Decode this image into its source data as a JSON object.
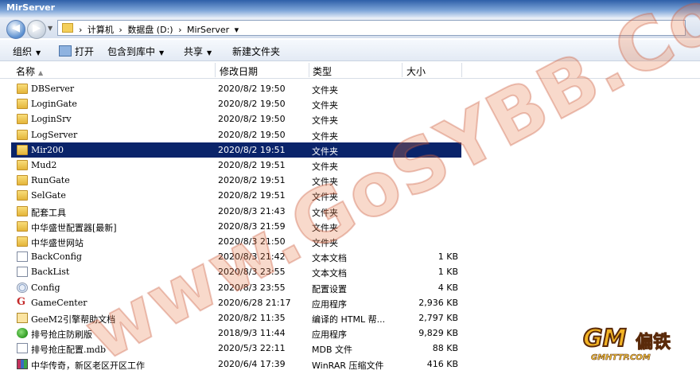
{
  "window": {
    "title": "MirServer"
  },
  "address": {
    "crumbs": [
      "›",
      "计算机",
      "›",
      "数据盘 (D:)",
      "›",
      "MirServer",
      "▾"
    ]
  },
  "toolbar": {
    "organize": "组织",
    "open": "打开",
    "include_in_library": "包含到库中",
    "share": "共享",
    "new_folder": "新建文件夹"
  },
  "columns": {
    "name": "名称",
    "date": "修改日期",
    "type": "类型",
    "size": "大小"
  },
  "files": [
    {
      "name": "DBServer",
      "date": "2020/8/2 19:50",
      "type": "文件夹",
      "size": "",
      "icon": "folder-icon"
    },
    {
      "name": "LoginGate",
      "date": "2020/8/2 19:50",
      "type": "文件夹",
      "size": "",
      "icon": "folder-icon"
    },
    {
      "name": "LoginSrv",
      "date": "2020/8/2 19:50",
      "type": "文件夹",
      "size": "",
      "icon": "folder-icon"
    },
    {
      "name": "LogServer",
      "date": "2020/8/2 19:50",
      "type": "文件夹",
      "size": "",
      "icon": "folder-icon"
    },
    {
      "name": "Mir200",
      "date": "2020/8/2 19:51",
      "type": "文件夹",
      "size": "",
      "icon": "folder-icon",
      "selected": true
    },
    {
      "name": "Mud2",
      "date": "2020/8/2 19:51",
      "type": "文件夹",
      "size": "",
      "icon": "folder-icon"
    },
    {
      "name": "RunGate",
      "date": "2020/8/2 19:51",
      "type": "文件夹",
      "size": "",
      "icon": "folder-icon"
    },
    {
      "name": "SelGate",
      "date": "2020/8/2 19:51",
      "type": "文件夹",
      "size": "",
      "icon": "folder-icon"
    },
    {
      "name": "配套工具",
      "date": "2020/8/3 21:43",
      "type": "文件夹",
      "size": "",
      "icon": "folder-icon"
    },
    {
      "name": "中华盛世配置器[最新]",
      "date": "2020/8/3 21:59",
      "type": "文件夹",
      "size": "",
      "icon": "folder-icon"
    },
    {
      "name": "中华盛世网站",
      "date": "2020/8/3 21:50",
      "type": "文件夹",
      "size": "",
      "icon": "folder-icon"
    },
    {
      "name": "BackConfig",
      "date": "2020/8/3 21:42",
      "type": "文本文档",
      "size": "1 KB",
      "icon": "text-document-icon"
    },
    {
      "name": "BackList",
      "date": "2020/8/3 23:55",
      "type": "文本文档",
      "size": "1 KB",
      "icon": "text-document-icon"
    },
    {
      "name": "Config",
      "date": "2020/8/3 23:55",
      "type": "配置设置",
      "size": "4 KB",
      "icon": "config-icon"
    },
    {
      "name": "GameCenter",
      "date": "2020/6/28 21:17",
      "type": "应用程序",
      "size": "2,936 KB",
      "icon": "gamecenter-app-icon"
    },
    {
      "name": "GeeM2引擎帮助文档",
      "date": "2020/8/2 11:35",
      "type": "编译的 HTML 帮...",
      "size": "2,797 KB",
      "icon": "help-document-icon"
    },
    {
      "name": "排号抢庄防刷版",
      "date": "2018/9/3 11:44",
      "type": "应用程序",
      "size": "9,829 KB",
      "icon": "apple-app-icon"
    },
    {
      "name": "排号抢庄配置.mdb",
      "date": "2020/5/3 22:11",
      "type": "MDB 文件",
      "size": "88 KB",
      "icon": "mdb-file-icon"
    },
    {
      "name": "中华传奇，新区老区开区工作",
      "date": "2020/6/4 17:39",
      "type": "WinRAR 压缩文件",
      "size": "416 KB",
      "icon": "winrar-archive-icon"
    }
  ],
  "watermark": {
    "text": "www.GoSYBB.Com"
  },
  "logo": {
    "brand": "GM",
    "cn": "偏铁",
    "url": "GMHTTP.COM"
  }
}
